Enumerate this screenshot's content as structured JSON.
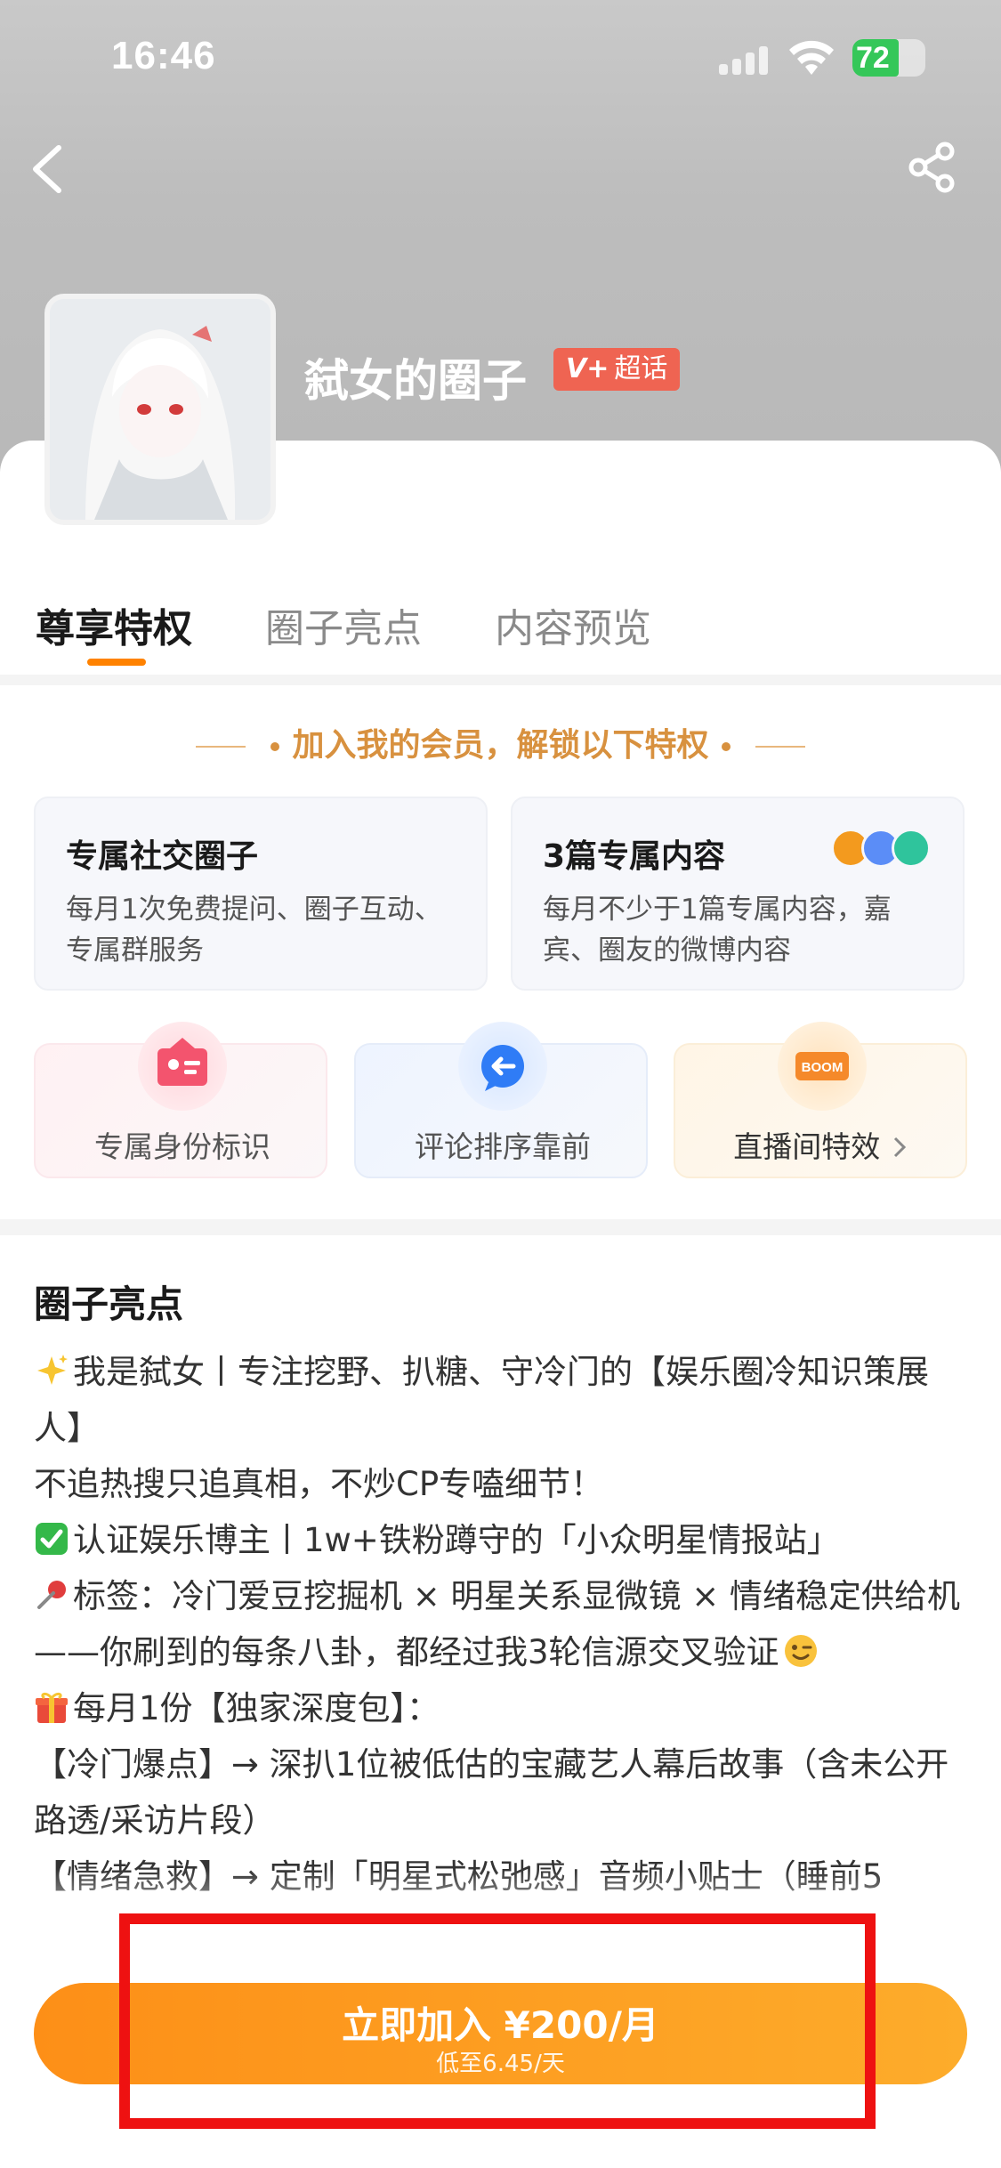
{
  "status_bar": {
    "time": "16:46",
    "battery": "72"
  },
  "header": {
    "circle_name": "弑女的圈子",
    "badge_label": "超话",
    "badge_prefix": "V+"
  },
  "tabs": [
    {
      "label": "尊享特权",
      "active": true
    },
    {
      "label": "圈子亮点",
      "active": false
    },
    {
      "label": "内容预览",
      "active": false
    }
  ],
  "privileges": {
    "heading": "加入我的会员，解锁以下特权",
    "cards": [
      {
        "title": "专属社交圈子",
        "desc": "每月1次免费提问、圈子互动、专属群服务"
      },
      {
        "title": "3篇专属内容",
        "desc": "每月不少于1篇专属内容，嘉宾、圈友的微博内容"
      }
    ],
    "mini_cards": [
      {
        "label": "专属身份标识",
        "icon": "identity-badge-icon"
      },
      {
        "label": "评论排序靠前",
        "icon": "comment-priority-icon"
      },
      {
        "label": "直播间特效",
        "icon": "boom-effect-icon"
      }
    ],
    "boom_text": "BOOM"
  },
  "highlights": {
    "title": "圈子亮点",
    "lines": [
      "我是弑女丨专注挖野、扒糖、守冷门的【娱乐圈冷知识策展人】",
      "不追热搜只追真相，不炒CP专嗑细节！",
      "认证娱乐博主丨1w+铁粉蹲守的「小众明星情报站」",
      "标签：冷门爱豆挖掘机 × 明星关系显微镜 × 情绪稳定供给机",
      "——你刷到的每条八卦，都经过我3轮信源交叉验证",
      "每月1份【独家深度包】：",
      "【冷门爆点】→ 深扒1位被低估的宝藏艺人幕后故事（含未公开路透/采访片段）",
      "【情绪急救】→ 定制「明星式松弛感」音频小贴士（睡前5"
    ]
  },
  "join": {
    "main": "立即加入 ¥200/月",
    "sub": "低至6.45/天"
  },
  "colors": {
    "accent": "#ff8200",
    "gold_heading": "#d8913f",
    "badge_red": "#ef6452",
    "highlight_box": "#ee1111"
  }
}
